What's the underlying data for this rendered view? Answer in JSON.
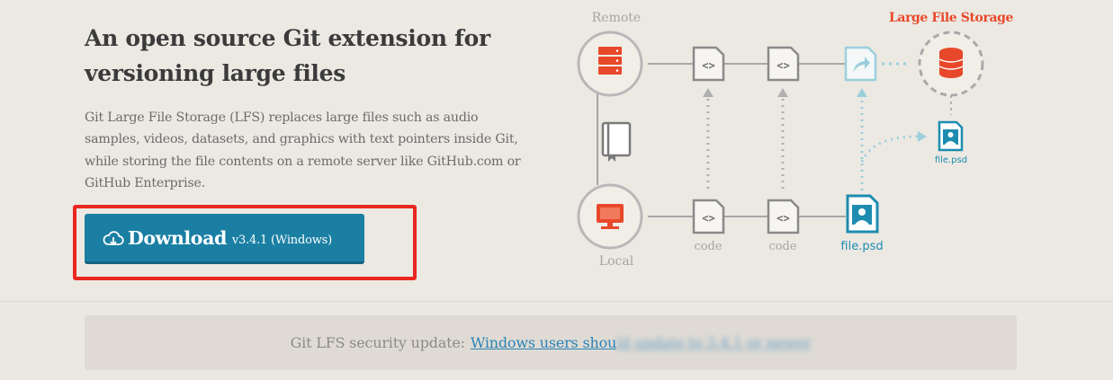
{
  "hero": {
    "title": "An open source Git extension for versioning large files",
    "description": "Git Large File Storage (LFS) replaces large files such as audio samples, videos, datasets, and graphics with text pointers inside Git, while storing the file contents on a remote server like GitHub.com or GitHub Enterprise."
  },
  "download": {
    "label": "Download",
    "version": "v3.4.1 (Windows)",
    "icon": "cloud-download-icon"
  },
  "diagram": {
    "remote_label": "Remote",
    "local_label": "Local",
    "lfs_label": "Large File Storage",
    "code_label_1": "code",
    "code_label_2": "code",
    "file_label_local": "file.psd",
    "file_label_lfs": "file.psd"
  },
  "notice": {
    "prefix": "Git LFS security update:",
    "link_visible": "Windows users shou",
    "link_blurred": "ld update to 3.4.1 or newer"
  },
  "colors": {
    "accent": "#1a7fa3",
    "lfs_orange": "#e8482a",
    "highlight_red": "#e8271f",
    "teal": "#1d8cb0"
  }
}
